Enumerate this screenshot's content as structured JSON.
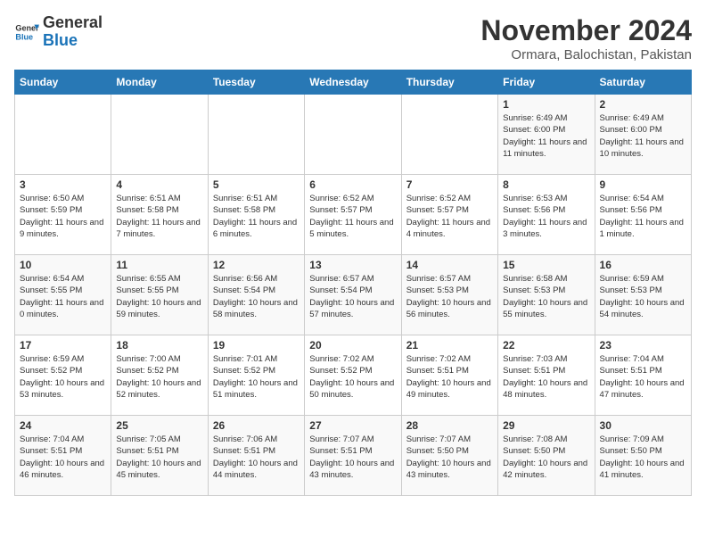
{
  "header": {
    "logo_line1": "General",
    "logo_line2": "Blue",
    "title": "November 2024",
    "subtitle": "Ormara, Balochistan, Pakistan"
  },
  "days_of_week": [
    "Sunday",
    "Monday",
    "Tuesday",
    "Wednesday",
    "Thursday",
    "Friday",
    "Saturday"
  ],
  "weeks": [
    [
      {
        "day": "",
        "info": ""
      },
      {
        "day": "",
        "info": ""
      },
      {
        "day": "",
        "info": ""
      },
      {
        "day": "",
        "info": ""
      },
      {
        "day": "",
        "info": ""
      },
      {
        "day": "1",
        "info": "Sunrise: 6:49 AM\nSunset: 6:00 PM\nDaylight: 11 hours and 11 minutes."
      },
      {
        "day": "2",
        "info": "Sunrise: 6:49 AM\nSunset: 6:00 PM\nDaylight: 11 hours and 10 minutes."
      }
    ],
    [
      {
        "day": "3",
        "info": "Sunrise: 6:50 AM\nSunset: 5:59 PM\nDaylight: 11 hours and 9 minutes."
      },
      {
        "day": "4",
        "info": "Sunrise: 6:51 AM\nSunset: 5:58 PM\nDaylight: 11 hours and 7 minutes."
      },
      {
        "day": "5",
        "info": "Sunrise: 6:51 AM\nSunset: 5:58 PM\nDaylight: 11 hours and 6 minutes."
      },
      {
        "day": "6",
        "info": "Sunrise: 6:52 AM\nSunset: 5:57 PM\nDaylight: 11 hours and 5 minutes."
      },
      {
        "day": "7",
        "info": "Sunrise: 6:52 AM\nSunset: 5:57 PM\nDaylight: 11 hours and 4 minutes."
      },
      {
        "day": "8",
        "info": "Sunrise: 6:53 AM\nSunset: 5:56 PM\nDaylight: 11 hours and 3 minutes."
      },
      {
        "day": "9",
        "info": "Sunrise: 6:54 AM\nSunset: 5:56 PM\nDaylight: 11 hours and 1 minute."
      }
    ],
    [
      {
        "day": "10",
        "info": "Sunrise: 6:54 AM\nSunset: 5:55 PM\nDaylight: 11 hours and 0 minutes."
      },
      {
        "day": "11",
        "info": "Sunrise: 6:55 AM\nSunset: 5:55 PM\nDaylight: 10 hours and 59 minutes."
      },
      {
        "day": "12",
        "info": "Sunrise: 6:56 AM\nSunset: 5:54 PM\nDaylight: 10 hours and 58 minutes."
      },
      {
        "day": "13",
        "info": "Sunrise: 6:57 AM\nSunset: 5:54 PM\nDaylight: 10 hours and 57 minutes."
      },
      {
        "day": "14",
        "info": "Sunrise: 6:57 AM\nSunset: 5:53 PM\nDaylight: 10 hours and 56 minutes."
      },
      {
        "day": "15",
        "info": "Sunrise: 6:58 AM\nSunset: 5:53 PM\nDaylight: 10 hours and 55 minutes."
      },
      {
        "day": "16",
        "info": "Sunrise: 6:59 AM\nSunset: 5:53 PM\nDaylight: 10 hours and 54 minutes."
      }
    ],
    [
      {
        "day": "17",
        "info": "Sunrise: 6:59 AM\nSunset: 5:52 PM\nDaylight: 10 hours and 53 minutes."
      },
      {
        "day": "18",
        "info": "Sunrise: 7:00 AM\nSunset: 5:52 PM\nDaylight: 10 hours and 52 minutes."
      },
      {
        "day": "19",
        "info": "Sunrise: 7:01 AM\nSunset: 5:52 PM\nDaylight: 10 hours and 51 minutes."
      },
      {
        "day": "20",
        "info": "Sunrise: 7:02 AM\nSunset: 5:52 PM\nDaylight: 10 hours and 50 minutes."
      },
      {
        "day": "21",
        "info": "Sunrise: 7:02 AM\nSunset: 5:51 PM\nDaylight: 10 hours and 49 minutes."
      },
      {
        "day": "22",
        "info": "Sunrise: 7:03 AM\nSunset: 5:51 PM\nDaylight: 10 hours and 48 minutes."
      },
      {
        "day": "23",
        "info": "Sunrise: 7:04 AM\nSunset: 5:51 PM\nDaylight: 10 hours and 47 minutes."
      }
    ],
    [
      {
        "day": "24",
        "info": "Sunrise: 7:04 AM\nSunset: 5:51 PM\nDaylight: 10 hours and 46 minutes."
      },
      {
        "day": "25",
        "info": "Sunrise: 7:05 AM\nSunset: 5:51 PM\nDaylight: 10 hours and 45 minutes."
      },
      {
        "day": "26",
        "info": "Sunrise: 7:06 AM\nSunset: 5:51 PM\nDaylight: 10 hours and 44 minutes."
      },
      {
        "day": "27",
        "info": "Sunrise: 7:07 AM\nSunset: 5:51 PM\nDaylight: 10 hours and 43 minutes."
      },
      {
        "day": "28",
        "info": "Sunrise: 7:07 AM\nSunset: 5:50 PM\nDaylight: 10 hours and 43 minutes."
      },
      {
        "day": "29",
        "info": "Sunrise: 7:08 AM\nSunset: 5:50 PM\nDaylight: 10 hours and 42 minutes."
      },
      {
        "day": "30",
        "info": "Sunrise: 7:09 AM\nSunset: 5:50 PM\nDaylight: 10 hours and 41 minutes."
      }
    ]
  ]
}
